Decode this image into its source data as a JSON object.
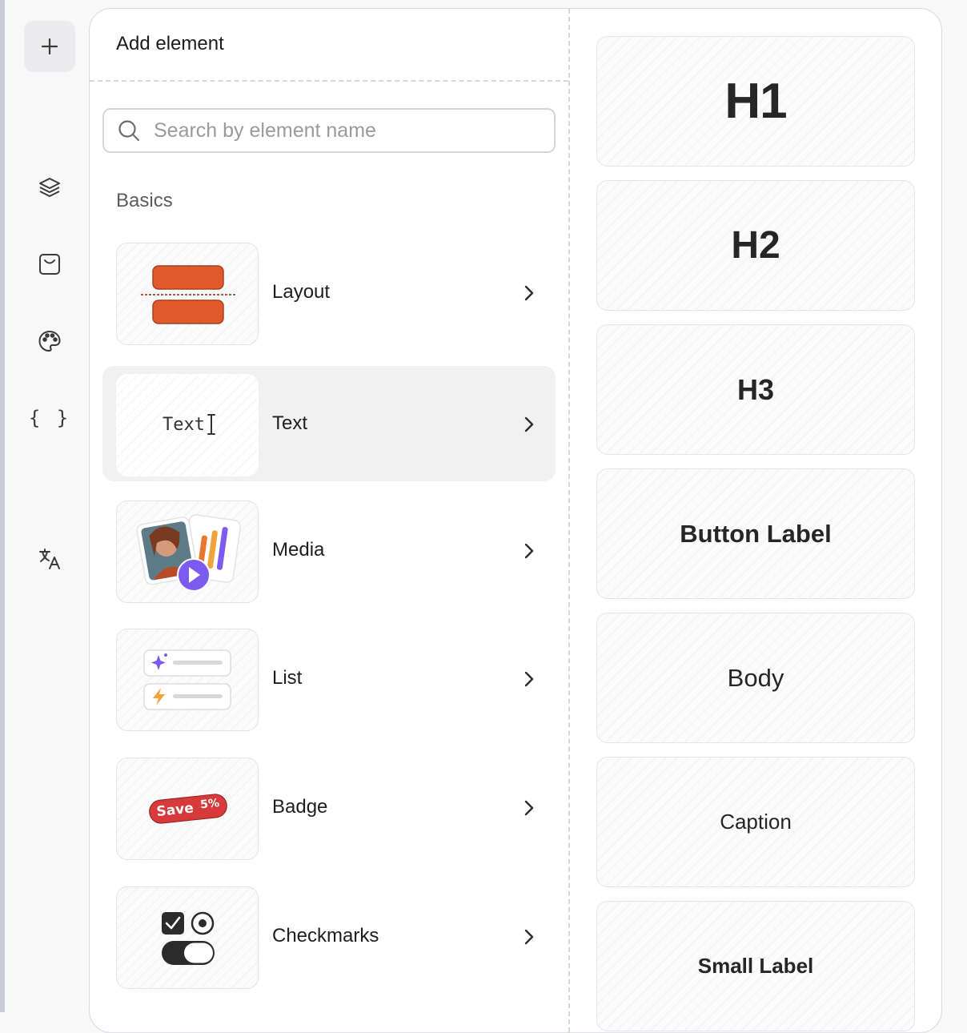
{
  "rail": {
    "items": [
      {
        "icon": "plus-icon"
      },
      {
        "icon": "layers-icon"
      },
      {
        "icon": "paywall-icon"
      },
      {
        "icon": "palette-icon"
      },
      {
        "icon": "braces-icon",
        "label": "{ }"
      },
      {
        "icon": "translate-icon"
      }
    ]
  },
  "panel": {
    "title": "Add element",
    "search": {
      "placeholder": "Search by element name",
      "value": ""
    },
    "section": "Basics",
    "items": [
      {
        "label": "Layout",
        "icon": "layout-thumbnail"
      },
      {
        "label": "Text",
        "icon": "text-thumbnail",
        "thumb_text": "Text",
        "active": true
      },
      {
        "label": "Media",
        "icon": "media-thumbnail"
      },
      {
        "label": "List",
        "icon": "list-thumbnail"
      },
      {
        "label": "Badge",
        "icon": "badge-thumbnail",
        "badge_text": "Save",
        "badge_value": "5%"
      },
      {
        "label": "Checkmarks",
        "icon": "checkmarks-thumbnail"
      }
    ]
  },
  "text_styles": [
    "H1",
    "H2",
    "H3",
    "Button Label",
    "Body",
    "Caption",
    "Small Label"
  ],
  "colors": {
    "layout_orange": "#e05a2b",
    "badge_red": "#d63a3a",
    "media_purple": "#7c5cf0",
    "accent_dark": "#2b2b2b"
  }
}
